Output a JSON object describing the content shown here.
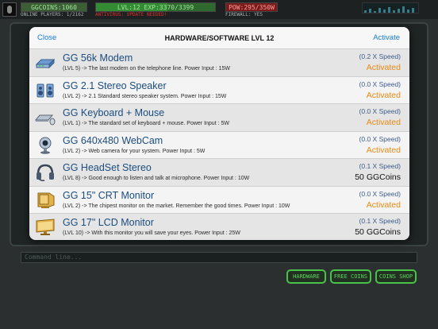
{
  "hud": {
    "coins": "GGCOINS:1060",
    "online": "ONLINE PLAYERS: 1/2162",
    "level": "LVL:12  EXP:3370/3399",
    "antivirus": "ANTIVIRUS: UPDATE NEEDED!",
    "power": "POW:295/350W",
    "firewall": "FIREWALL: YES"
  },
  "modal": {
    "close_label": "Close",
    "title": "HARDWARE/SOFTWARE LVL 12",
    "activate_label": "Activate"
  },
  "items": [
    {
      "icon": "modem-icon",
      "title": "GG 56k Modem",
      "desc": "(LVL 5) -> The last modem on the telephone line. Power Input : 15W",
      "speed": "(0.2 X Speed)",
      "status": "Activated",
      "status_type": "activated"
    },
    {
      "icon": "speaker-icon",
      "title": "GG 2.1 Stereo Speaker",
      "desc": "(LVL 2) -> 2.1 Standard stereo speaker system. Power Input : 15W",
      "speed": "(0.0 X Speed)",
      "status": "Activated",
      "status_type": "activated"
    },
    {
      "icon": "keyboard-mouse-icon",
      "title": "GG Keyboard + Mouse",
      "desc": "(LVL 1) -> The standard set of keyboard + mouse. Power Input : 5W",
      "speed": "(0.0 X Speed)",
      "status": "Activated",
      "status_type": "activated"
    },
    {
      "icon": "webcam-icon",
      "title": "GG 640x480 WebCam",
      "desc": "(LVL 2) -> Web camera for your system. Power Input : 5W",
      "speed": "(0.0 X Speed)",
      "status": "Activated",
      "status_type": "activated"
    },
    {
      "icon": "headset-icon",
      "title": "GG HeadSet Stereo",
      "desc": "(LVL 8) -> Good enough to listen and talk at microphone. Power Input : 10W",
      "speed": "(0.1 X Speed)",
      "status": "50 GGCoins",
      "status_type": "price"
    },
    {
      "icon": "crt-monitor-icon",
      "title": "GG 15\" CRT Monitor",
      "desc": "(LVL 2) -> The chipest monitor on the market. Remember the good times. Power Input : 10W",
      "speed": "(0.0 X Speed)",
      "status": "Activated",
      "status_type": "activated"
    },
    {
      "icon": "lcd-monitor-icon",
      "title": "GG 17\" LCD Monitor",
      "desc": "(LVL 10) -> With this monitor you will save your eyes. Power Input : 25W",
      "speed": "(0.1 X Speed)",
      "status": "50 GGCoins",
      "status_type": "price"
    }
  ],
  "command": {
    "placeholder": "Command line..."
  },
  "bottom_buttons": {
    "hardware": "HARDWARE",
    "free_coins": "FREE COINS",
    "coins_shop": "COINS SHOP"
  }
}
